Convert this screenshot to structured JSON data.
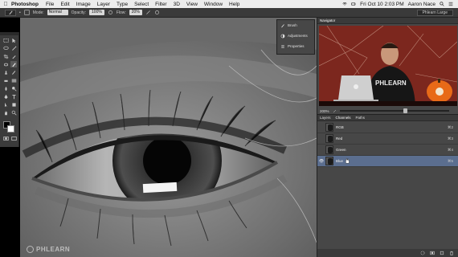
{
  "menubar": {
    "app_name": "Photoshop",
    "items": [
      "File",
      "Edit",
      "Image",
      "Layer",
      "Type",
      "Select",
      "Filter",
      "3D",
      "View",
      "Window",
      "Help"
    ],
    "datetime": "Fri Oct 10  2:03 PM",
    "user": "Aaron Nace"
  },
  "options_bar": {
    "mode_label": "Mode:",
    "mode_value": "Normal",
    "opacity_label": "Opacity:",
    "opacity_value": "100%",
    "flow_label": "Flow:",
    "flow_value": "20%",
    "workspace": "Phlearn Large"
  },
  "mini_panel": {
    "items": [
      "Brush",
      "Adjustments",
      "Properties"
    ]
  },
  "navigator": {
    "tab": "Navigator",
    "zoom": "200%"
  },
  "channels_panel": {
    "tabs": [
      "Layers",
      "Channels",
      "Paths"
    ],
    "active_tab": "Channels",
    "rows": [
      {
        "name": "RGB",
        "shortcut": "⌘2"
      },
      {
        "name": "Red",
        "shortcut": "⌘3"
      },
      {
        "name": "Green",
        "shortcut": "⌘4"
      },
      {
        "name": "Blue",
        "shortcut": "⌘5"
      }
    ],
    "selected": "Blue"
  },
  "watermark": "PHLEARN",
  "colors": {
    "selected_row": "#5b6e8f",
    "panel_bg": "#474747",
    "foreground": "#000000",
    "background": "#ffffff"
  }
}
